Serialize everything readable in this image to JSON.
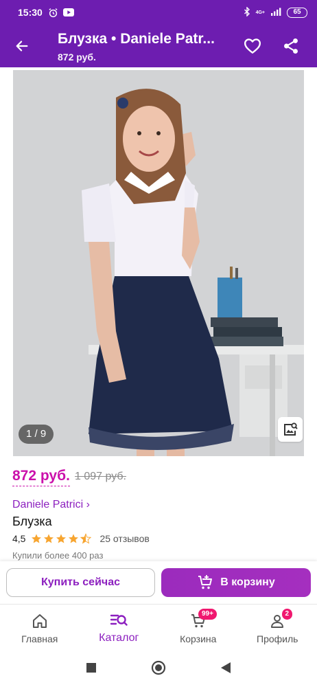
{
  "status_bar": {
    "time": "15:30",
    "network": "4G+",
    "battery": "65",
    "icons": [
      "alarm-icon",
      "youtube-icon",
      "bluetooth-icon",
      "signal-icon"
    ]
  },
  "header": {
    "title": "Блузка • Daniele Patr...",
    "subtitle": "872 руб.",
    "icons": [
      "back-arrow-icon",
      "heart-icon",
      "share-icon"
    ]
  },
  "gallery": {
    "counter": "1 / 9",
    "icons": [
      "image-search-icon"
    ]
  },
  "product": {
    "price": "872 руб.",
    "old_price": "1 097 руб.",
    "brand": "Daniele Patrici ›",
    "name": "Блузка",
    "rating": "4,5",
    "stars": 4.5,
    "reviews": "25 отзывов",
    "bought": "Купили более 400 раз"
  },
  "actions": {
    "buy_now": "Купить сейчас",
    "add_to_cart": "В корзину"
  },
  "bottom_nav": {
    "items": [
      {
        "label": "Главная",
        "icon": "home-icon"
      },
      {
        "label": "Каталог",
        "icon": "catalog-search-icon"
      },
      {
        "label": "Корзина",
        "icon": "cart-icon",
        "badge": "99+"
      },
      {
        "label": "Профиль",
        "icon": "profile-icon",
        "badge": "2"
      }
    ],
    "active": "Каталог"
  },
  "colors": {
    "brand_purple": "#6d1db0",
    "accent_magenta": "#cb11ab",
    "button_purple": "#9b2bbd",
    "badge_pink": "#f0186f"
  }
}
